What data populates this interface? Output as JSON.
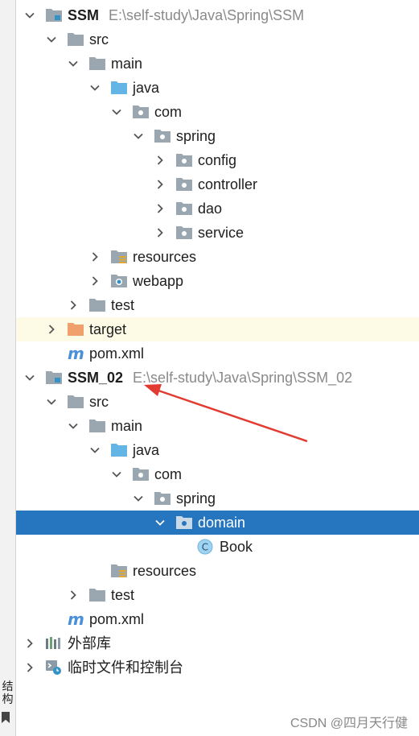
{
  "side_panel": {
    "label": "结构"
  },
  "tree": {
    "ssm": {
      "name": "SSM",
      "path": "E:\\self-study\\Java\\Spring\\SSM",
      "src": "src",
      "main": "main",
      "java": "java",
      "com": "com",
      "spring": "spring",
      "config": "config",
      "controller": "controller",
      "dao": "dao",
      "service": "service",
      "resources": "resources",
      "webapp": "webapp",
      "test": "test",
      "target": "target",
      "pom": "pom.xml"
    },
    "ssm02": {
      "name": "SSM_02",
      "path": "E:\\self-study\\Java\\Spring\\SSM_02",
      "src": "src",
      "main": "main",
      "java": "java",
      "com": "com",
      "spring": "spring",
      "domain": "domain",
      "book": "Book",
      "class_letter": "C",
      "resources": "resources",
      "test": "test",
      "pom": "pom.xml",
      "maven_letter": "m"
    },
    "external_libraries": "外部库",
    "scratches": "临时文件和控制台"
  },
  "watermark": "CSDN @四月天行健",
  "colors": {
    "selection": "#2675bf",
    "highlight_row": "#fdfbe6",
    "annotation_arrow": "#e23b32",
    "folder": "#9aa7b0",
    "source_folder": "#62b5e5",
    "excluded_folder": "#f0a06c"
  }
}
